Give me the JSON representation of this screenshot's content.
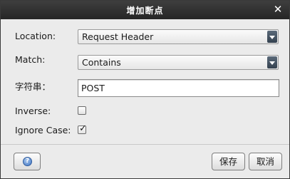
{
  "window": {
    "title": "增加断点",
    "close_icon": "close-icon"
  },
  "form": {
    "location_label": "Location:",
    "location_value": "Request Header",
    "match_label": "Match:",
    "match_value": "Contains",
    "string_label": "字符串：",
    "string_value": "POST",
    "inverse_label": "Inverse:",
    "inverse_checked": false,
    "ignore_case_label": "Ignore Case:",
    "ignore_case_checked": true,
    "checkmark_glyph": "✓"
  },
  "buttons": {
    "help_icon": "help-icon",
    "help_glyph": "?",
    "save_label": "保存",
    "cancel_label": "取消"
  },
  "colors": {
    "titlebar": "#2e2e2e",
    "dialog_bg": "#ebebeb",
    "help_icon_blue": "#3f74c4"
  }
}
